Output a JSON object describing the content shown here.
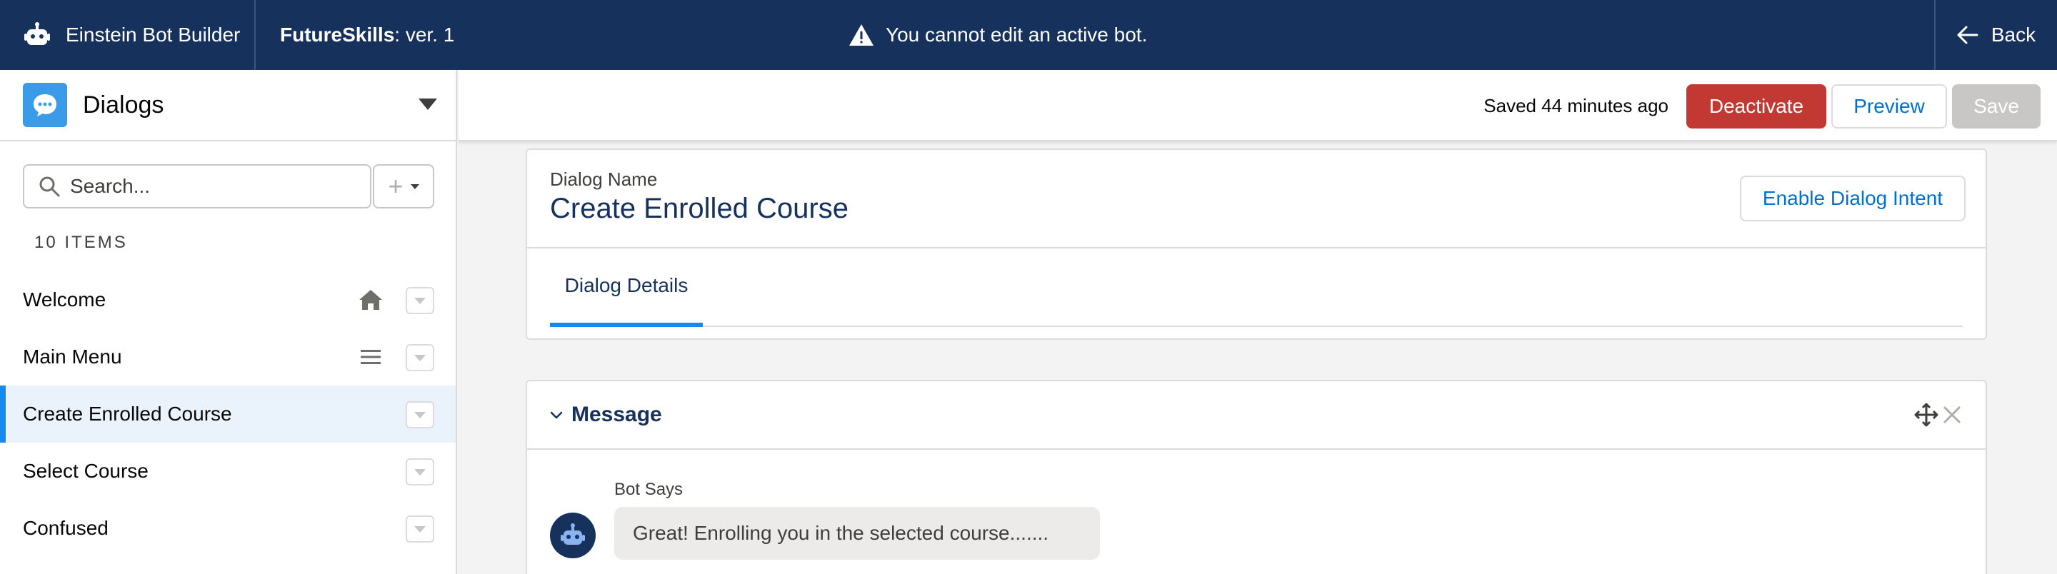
{
  "topbar": {
    "app_name": "Einstein Bot Builder",
    "bot_name": "FutureSkills",
    "bot_version": " : ver. 1",
    "warning": "You cannot edit an active bot.",
    "back_label": "Back"
  },
  "sidebar": {
    "title": "Dialogs",
    "search_placeholder": "Search...",
    "add_symbol": "+",
    "count_label": "10 ITEMS",
    "items": [
      {
        "label": "Welcome",
        "icon": "home-icon"
      },
      {
        "label": "Main Menu",
        "icon": "menu-lines-icon"
      },
      {
        "label": "Create Enrolled Course",
        "icon": "",
        "active": true
      },
      {
        "label": "Select Course",
        "icon": ""
      },
      {
        "label": "Confused",
        "icon": ""
      }
    ]
  },
  "header": {
    "saved_status": "Saved 44 minutes ago",
    "deactivate_label": "Deactivate",
    "preview_label": "Preview",
    "save_label": "Save"
  },
  "dialog": {
    "name_label": "Dialog Name",
    "name": "Create Enrolled Course",
    "enable_intent_label": "Enable Dialog Intent",
    "tabs": [
      {
        "label": "Dialog Details",
        "active": true
      }
    ]
  },
  "message_step": {
    "title": "Message",
    "bot_says_label": "Bot Says",
    "bot_message": "Great! Enrolling you in the selected course......."
  },
  "colors": {
    "topbar_bg": "#16325c",
    "brand_blue": "#0070d2",
    "deactivate_red": "#c23934",
    "active_item_bg": "#eaf3fc",
    "active_accent": "#1589ee"
  }
}
